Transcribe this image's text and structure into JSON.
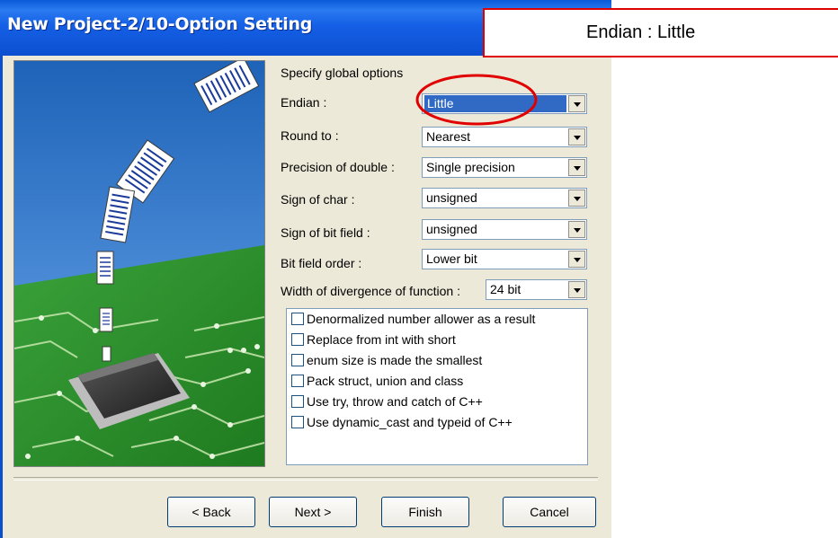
{
  "window": {
    "title": "New Project-2/10-Option Setting"
  },
  "options": {
    "heading": "Specify global options",
    "endian": {
      "label": "Endian :",
      "value": "Little"
    },
    "round_to": {
      "label": "Round to :",
      "value": "Nearest"
    },
    "precision_of_double": {
      "label": "Precision of double :",
      "value": "Single precision"
    },
    "sign_of_char": {
      "label": "Sign of char :",
      "value": "unsigned"
    },
    "sign_of_bit_field": {
      "label": "Sign of bit field :",
      "value": "unsigned"
    },
    "bit_field_order": {
      "label": "Bit field order :",
      "value": "Lower bit"
    },
    "width_of_divergence": {
      "label": "Width of divergence of function :",
      "value": "24 bit"
    }
  },
  "checkboxes": [
    {
      "label": "Denormalized number allower as a result",
      "checked": false
    },
    {
      "label": "Replace from int with short",
      "checked": false
    },
    {
      "label": "enum size is made the smallest",
      "checked": false
    },
    {
      "label": "Pack struct, union and class",
      "checked": false
    },
    {
      "label": "Use try, throw and catch of C++",
      "checked": false
    },
    {
      "label": "Use dynamic_cast and typeid of C++",
      "checked": false
    }
  ],
  "buttons": {
    "back": "< Back",
    "next": "Next >",
    "finish": "Finish",
    "cancel": "Cancel"
  },
  "annotation": {
    "text": "Endian : Little",
    "color": "#e00000"
  },
  "colors": {
    "titlebar": "#0a5ad8",
    "dialog_bg": "#ece9d8",
    "selection": "#316ac5",
    "pcb_green": "#2f8f2f",
    "sky_blue": "#3b78c9"
  }
}
